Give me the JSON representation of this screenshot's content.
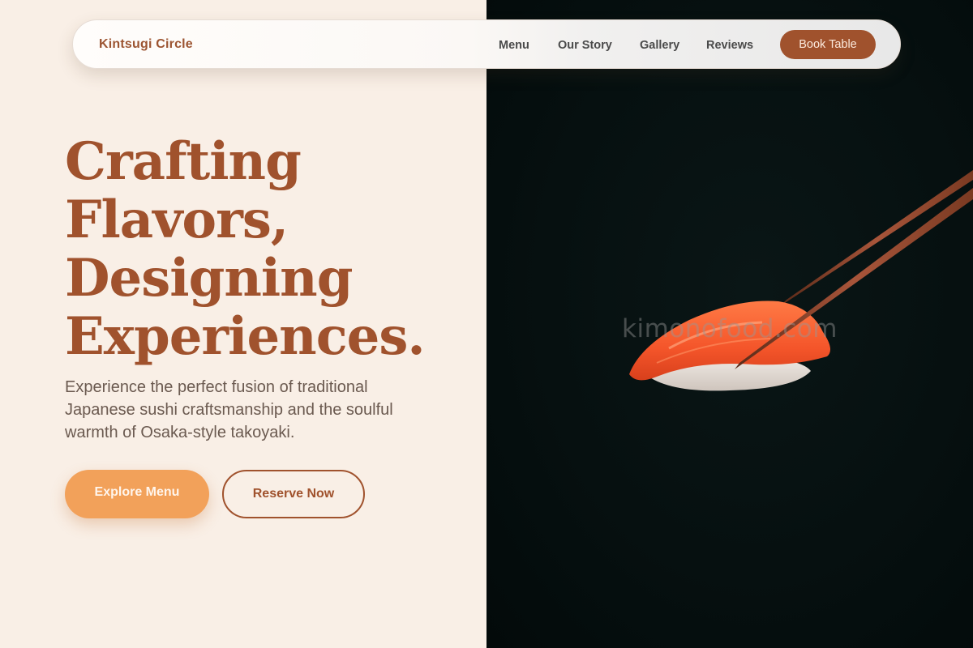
{
  "nav": {
    "brand": "Kintsugi Circle",
    "links": [
      "Menu",
      "Our Story",
      "Gallery",
      "Reviews"
    ],
    "cta": "Book Table"
  },
  "hero": {
    "title_lines": [
      "Crafting",
      "Flavors,",
      "Designing",
      "Experiences."
    ],
    "description": "Experience the perfect fusion of traditional Japanese sushi craftsmanship and the soulful warmth of Osaka-style takoyaki.",
    "primary_button": "Explore Menu",
    "secondary_button": "Reserve Now"
  },
  "image": {
    "watermark": "kimonofood.com"
  },
  "colors": {
    "accent": "#a0522d",
    "accent_light": "#f2a15a",
    "background_left": "#f9efe6",
    "background_right": "#061010"
  }
}
